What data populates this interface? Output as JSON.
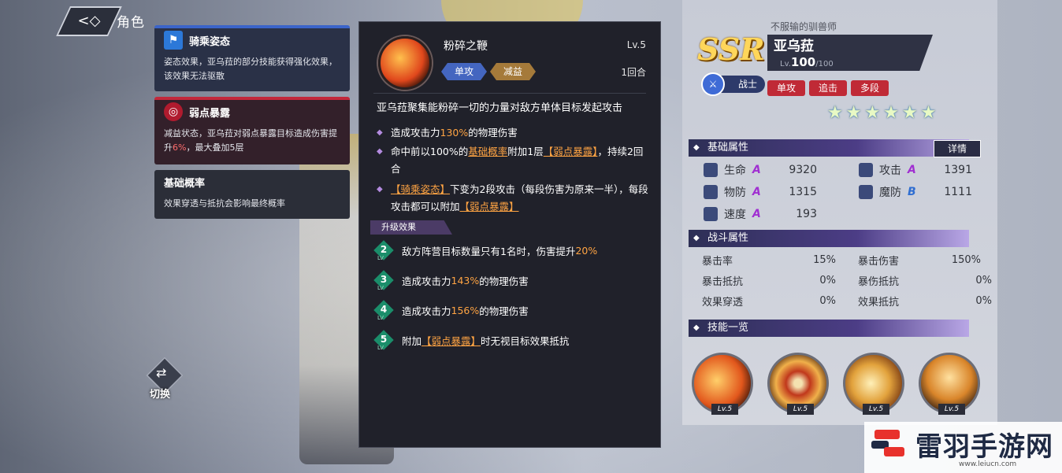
{
  "header": {
    "back_icon": "back-arrow-icon",
    "title": "角色"
  },
  "left_cards": {
    "card1": {
      "title": "骑乘姿态",
      "desc": "姿态效果，亚乌菈的部分技能获得强化效果，该效果无法驱散",
      "color": "#3b64c9"
    },
    "card2": {
      "title": "弱点暴露",
      "desc_a": "减益状态，亚乌菈对弱点暴露目标造成伤害提升",
      "desc_pct": "6%",
      "desc_b": "，最大叠加5层",
      "color": "#c3283b"
    },
    "card3": {
      "title": "基础概率",
      "desc": "效果穿透与抵抗会影响最终概率"
    },
    "switch_label": "切换"
  },
  "skill": {
    "name": "粉碎之鞭",
    "level": "Lv.5",
    "tags": [
      "单攻",
      "减益"
    ],
    "cooldown": "1回合",
    "desc": "亚乌菈聚集能粉碎一切的力量对敌方单体目标发起攻击",
    "b1_pre": "造成攻击力",
    "b1_pct": "130%",
    "b1_post": "的物理伤害",
    "b2_pre": "命中前以100%的",
    "b2_link": "基础概率",
    "b2_mid": "附加1层",
    "b2_kw": "【弱点暴露】",
    "b2_post": "，持续2回合",
    "b3_kw": "【骑乘姿态】",
    "b3_mid": "下变为2段攻击（每段伤害为原来一半），每段攻击都可以附加",
    "b3_kw2": "【弱点暴露】",
    "upgrade_label": "升级效果",
    "upgrades": [
      {
        "lv": "2",
        "pre": "敌方阵营目标数量只有1名时，伤害提升",
        "hl": "20%",
        "post": ""
      },
      {
        "lv": "3",
        "pre": "造成攻击力",
        "hl": "143%",
        "post": "的物理伤害"
      },
      {
        "lv": "4",
        "pre": "造成攻击力",
        "hl": "156%",
        "post": "的物理伤害"
      },
      {
        "lv": "5",
        "pre": "附加",
        "hl": "【弱点暴露】",
        "post": "时无视目标效果抵抗"
      }
    ],
    "lv_small": "LV"
  },
  "hero": {
    "rarity": "SSR",
    "subtitle": "不服输的驯兽师",
    "name": "亚乌菈",
    "lv_prefix": "Lv.",
    "lv": "100",
    "lv_max": "/100",
    "class": "战士",
    "tags": [
      "单攻",
      "追击",
      "多段"
    ],
    "stars": "★★★★★★",
    "star_count": 6
  },
  "base_attr": {
    "title": "基础属性",
    "detail": "详情",
    "stats": [
      {
        "label": "生命",
        "grade": "A",
        "value": "9320"
      },
      {
        "label": "攻击",
        "grade": "A",
        "value": "1391"
      },
      {
        "label": "物防",
        "grade": "A",
        "value": "1315"
      },
      {
        "label": "魔防",
        "grade": "B",
        "value": "1111"
      },
      {
        "label": "速度",
        "grade": "A",
        "value": "193"
      }
    ]
  },
  "battle_attr": {
    "title": "战斗属性",
    "stats": [
      {
        "label": "暴击率",
        "value": "15%"
      },
      {
        "label": "暴击伤害",
        "value": "150%"
      },
      {
        "label": "暴击抵抗",
        "value": "0%"
      },
      {
        "label": "暴伤抵抗",
        "value": "0%"
      },
      {
        "label": "效果穿透",
        "value": "0%"
      },
      {
        "label": "效果抵抗",
        "value": "0%"
      }
    ]
  },
  "skills_overview": {
    "title": "技能一览",
    "levels": [
      "Lv.5",
      "Lv.5",
      "Lv.5",
      "Lv.5"
    ]
  },
  "watermark": {
    "text": "雷羽手游网",
    "url": "www.leiucn.com"
  }
}
